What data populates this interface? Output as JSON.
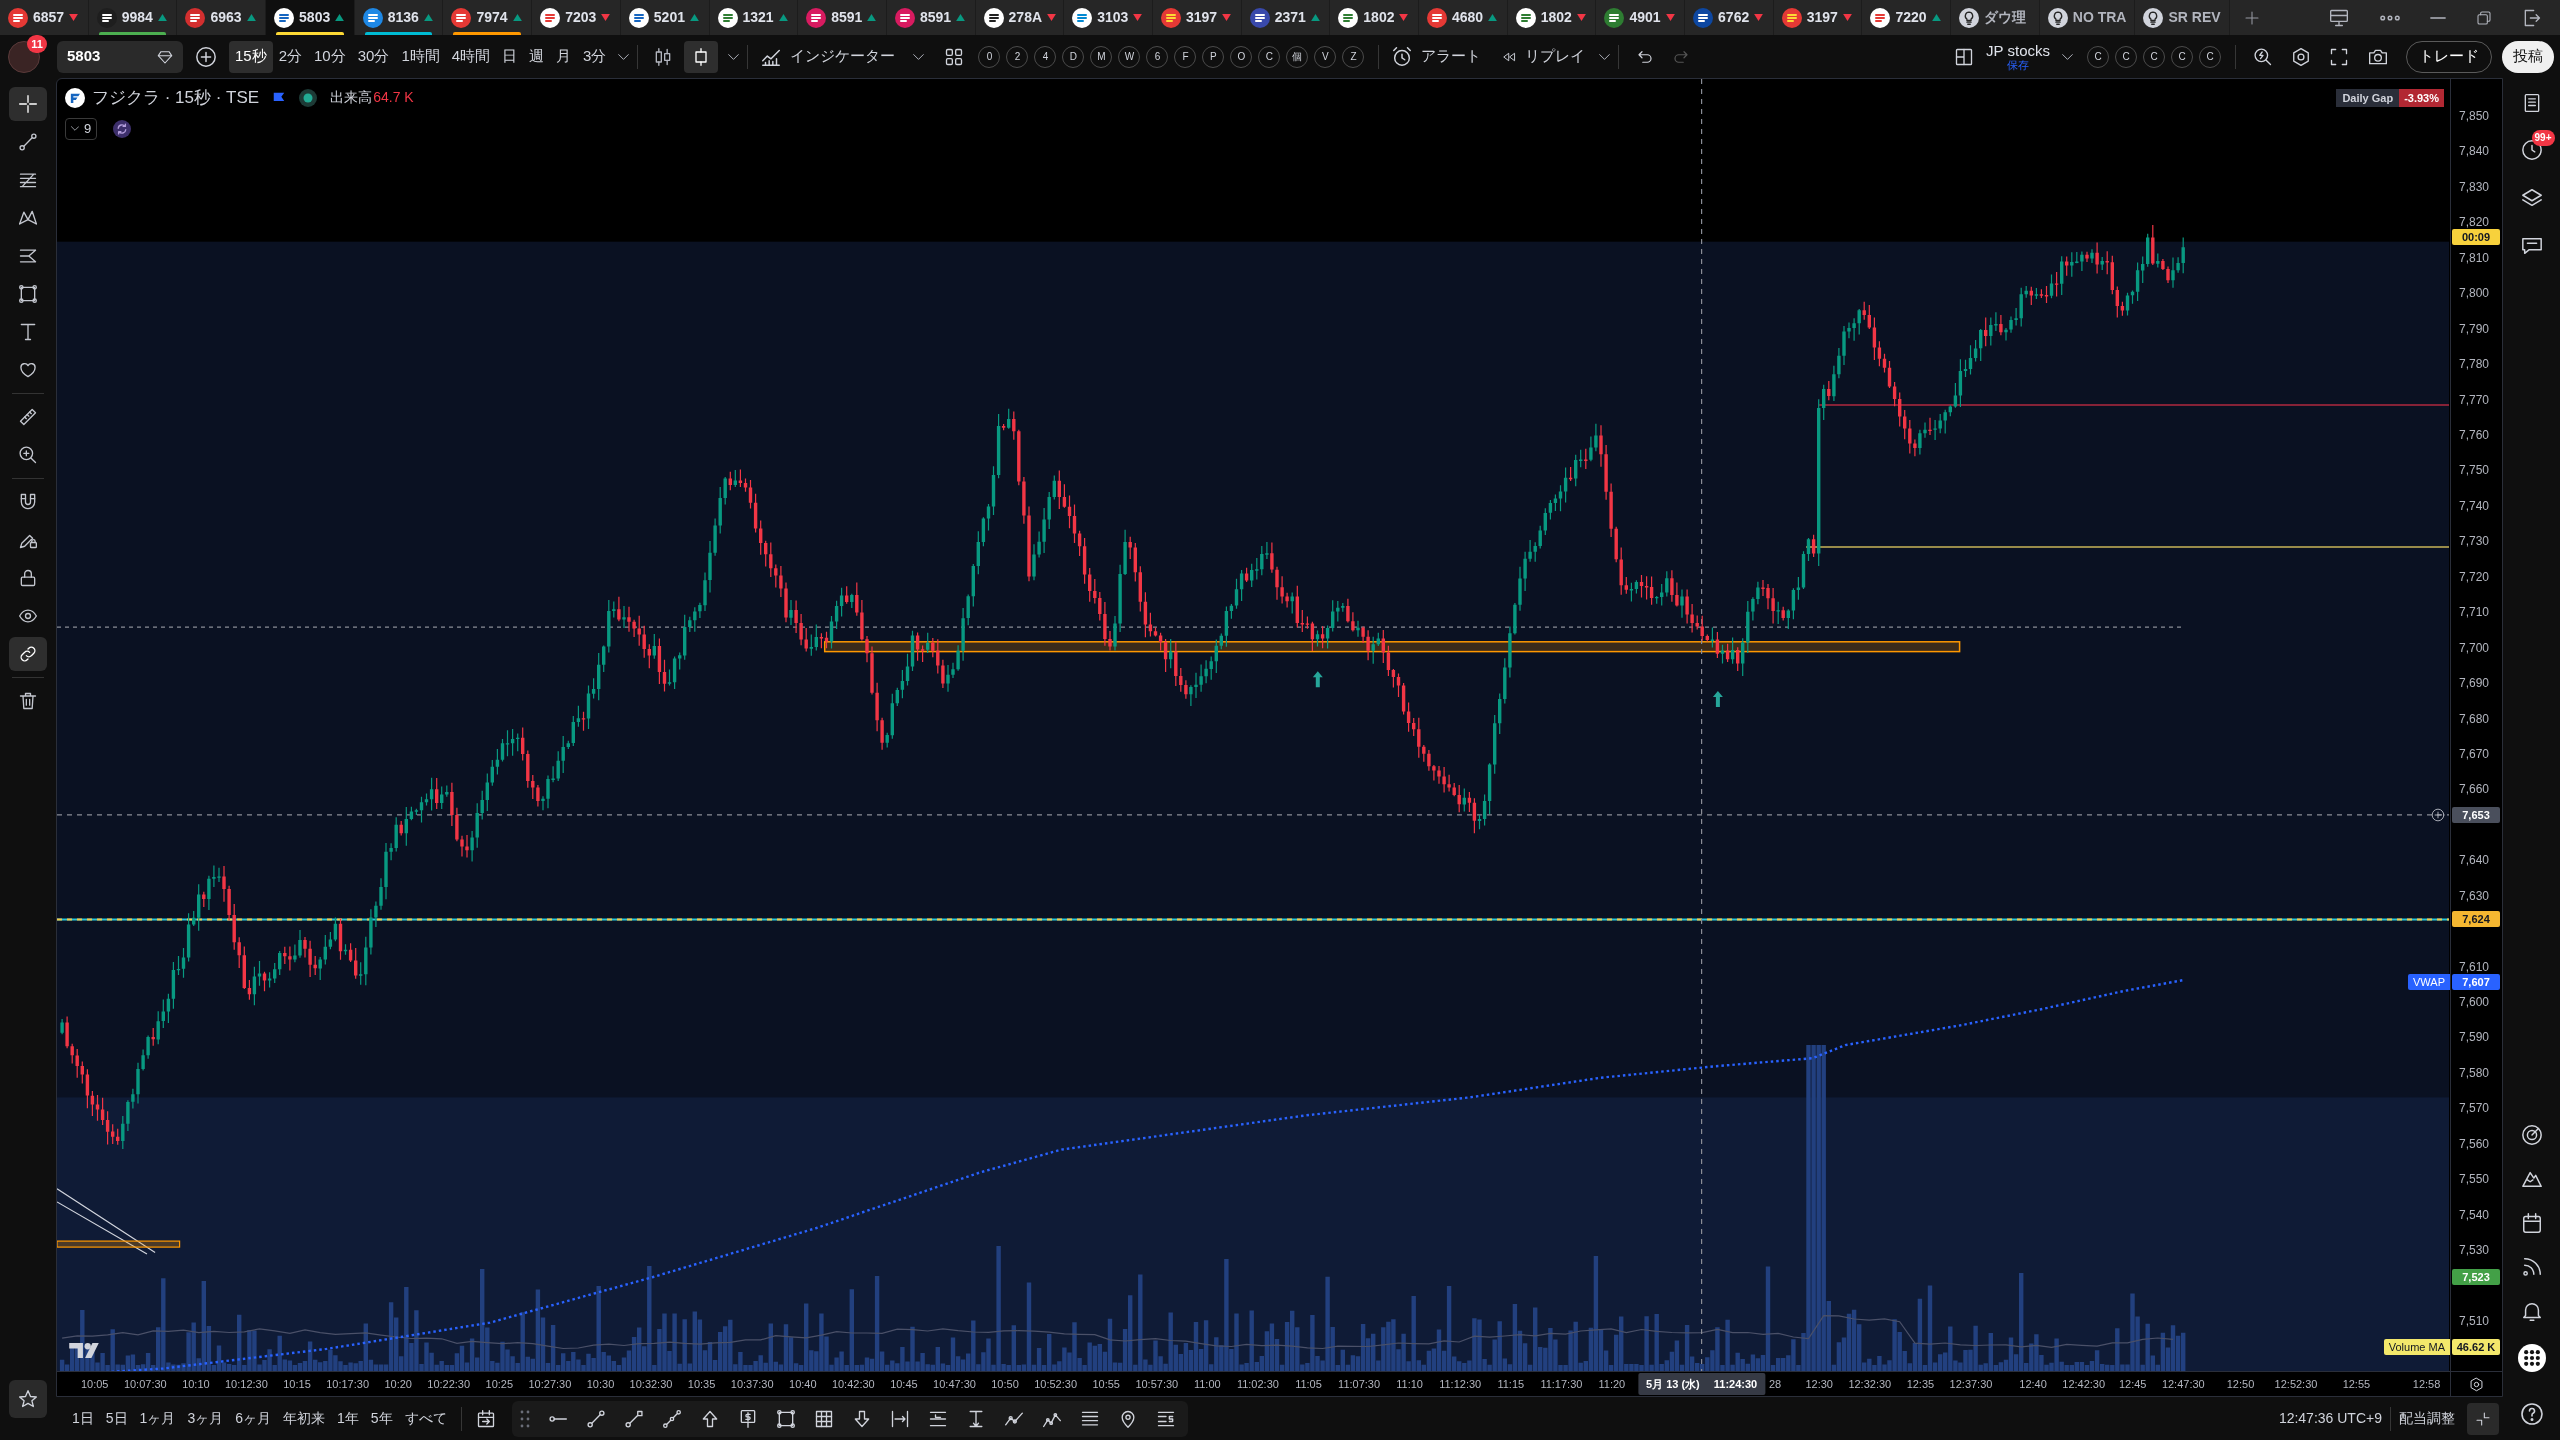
{
  "tabs": [
    {
      "kind": "symbol",
      "symbol": "6857",
      "rising": false,
      "selected": false
    },
    {
      "kind": "symbol",
      "symbol": "9984",
      "rising": true,
      "selected": false,
      "color": "#4caf50"
    },
    {
      "kind": "symbol",
      "symbol": "6963",
      "rising": true,
      "selected": false
    },
    {
      "kind": "symbol",
      "symbol": "5803",
      "rising": true,
      "selected": true,
      "color": "#fdd835"
    },
    {
      "kind": "symbol",
      "symbol": "8136",
      "rising": true,
      "selected": false,
      "color": "#00bcd4"
    },
    {
      "kind": "symbol",
      "symbol": "7974",
      "rising": true,
      "selected": false,
      "color": "#ff9800"
    },
    {
      "kind": "symbol",
      "symbol": "7203",
      "rising": false,
      "selected": false
    },
    {
      "kind": "symbol",
      "symbol": "5201",
      "rising": true,
      "selected": false
    },
    {
      "kind": "symbol",
      "symbol": "1321",
      "rising": true,
      "selected": false
    },
    {
      "kind": "symbol",
      "symbol": "8591",
      "rising": true,
      "selected": false
    },
    {
      "kind": "symbol",
      "symbol": "8591",
      "rising": true,
      "selected": false
    },
    {
      "kind": "symbol",
      "symbol": "278A",
      "rising": false,
      "selected": false
    },
    {
      "kind": "symbol",
      "symbol": "3103",
      "rising": false,
      "selected": false
    },
    {
      "kind": "symbol",
      "symbol": "3197",
      "rising": false,
      "selected": false
    },
    {
      "kind": "symbol",
      "symbol": "2371",
      "rising": true,
      "selected": false
    },
    {
      "kind": "symbol",
      "symbol": "1802",
      "rising": false,
      "selected": false
    },
    {
      "kind": "symbol",
      "symbol": "4680",
      "rising": true,
      "selected": false
    },
    {
      "kind": "symbol",
      "symbol": "1802",
      "rising": false,
      "selected": false
    },
    {
      "kind": "symbol",
      "symbol": "4901",
      "rising": false,
      "selected": false
    },
    {
      "kind": "symbol",
      "symbol": "6762",
      "rising": false,
      "selected": false
    },
    {
      "kind": "symbol",
      "symbol": "3197",
      "rising": false,
      "selected": false
    },
    {
      "kind": "symbol",
      "symbol": "7220",
      "rising": true,
      "selected": false
    },
    {
      "kind": "layout",
      "symbol": "ダウ理",
      "selected": false
    },
    {
      "kind": "layout",
      "symbol": "NO TRA",
      "selected": false
    },
    {
      "kind": "layout",
      "symbol": "SR REV",
      "selected": false
    }
  ],
  "toolbar": {
    "notification_count": "11",
    "symbol_field": {
      "value": "5803"
    },
    "intervals": [
      {
        "label": "15秒",
        "selected": true
      },
      {
        "label": "2分",
        "selected": false
      },
      {
        "label": "10分",
        "selected": false
      },
      {
        "label": "30分",
        "selected": false
      },
      {
        "label": "1時間",
        "selected": false
      },
      {
        "label": "4時間",
        "selected": false
      },
      {
        "label": "日",
        "selected": false
      },
      {
        "label": "週",
        "selected": false
      },
      {
        "label": "月",
        "selected": false
      },
      {
        "label": "3分",
        "selected": false
      }
    ],
    "chart_styles": [
      {
        "selected": false
      },
      {
        "selected": true
      }
    ],
    "indicators": "インジケーター",
    "shortcuts": [
      "0",
      "2",
      "4",
      "D",
      "M",
      "W",
      "6",
      "F",
      "P",
      "O",
      "C",
      "個",
      "V",
      "Z"
    ],
    "alert": "アラート",
    "replay": "リプレイ",
    "layout": {
      "name": "JP stocks",
      "status": "保存"
    },
    "watchlists": [
      "C",
      "C",
      "C",
      "C",
      "C"
    ],
    "trade_button": "トレード",
    "publish_button": "投稿"
  },
  "drawing_tools": [
    {
      "selected": true
    },
    {
      "selected": false
    },
    {
      "selected": false
    },
    {
      "selected": false
    },
    {
      "selected": false
    },
    {
      "selected": false
    },
    {
      "selected": false
    },
    {
      "selected": false
    },
    {
      "selected": false
    },
    {
      "selected": false
    },
    {
      "selected": false
    },
    {
      "selected": false
    },
    {
      "selected": false
    },
    {
      "selected": false
    },
    {
      "selected": true
    },
    {
      "selected": false
    }
  ],
  "chart": {
    "legend": {
      "title": "フジクラ · 15秒 · TSE",
      "volume_label": "出来高",
      "volume_value": "64.7 K",
      "hidden_count": "9"
    },
    "daily_gap": {
      "label": "Daily Gap",
      "value": "-3.93%"
    },
    "price_ticks": [
      "7,850",
      "7,840",
      "7,830",
      "7,820",
      "7,810",
      "7,800",
      "7,790",
      "7,780",
      "7,770",
      "7,760",
      "7,750",
      "7,740",
      "7,730",
      "7,720",
      "7,710",
      "7,700",
      "7,690",
      "7,680",
      "7,670",
      "7,660",
      "7,640",
      "7,630",
      "7,610",
      "7,600",
      "7,590",
      "7,580",
      "7,570",
      "7,560",
      "7,550",
      "7,540",
      "7,530",
      "7,510"
    ],
    "price_badges": [
      {
        "label": "00:09",
        "color": "#f7d13c"
      },
      {
        "label": "7,653",
        "color": "#4a4f5c"
      },
      {
        "label": "7,624",
        "color": "#f5b731"
      },
      {
        "title": "VWAP",
        "label": "7,607",
        "color": "#2962ff"
      },
      {
        "label": "7,523",
        "color": "#43a047"
      },
      {
        "title": "Volume MA",
        "label": "46.62 K",
        "color": "#f3e86b"
      }
    ],
    "time_ticks": [
      "10:05",
      "10:07:30",
      "10:10",
      "10:12:30",
      "10:15",
      "10:17:30",
      "10:20",
      "10:22:30",
      "10:25",
      "10:27:30",
      "10:30",
      "10:32:30",
      "10:35",
      "10:37:30",
      "10:40",
      "10:42:30",
      "10:45",
      "10:47:30",
      "10:50",
      "10:52:30",
      "10:55",
      "10:57:30",
      "11:00",
      "11:02:30",
      "11:05",
      "11:07:30",
      "11:10",
      "11:12:30",
      "11:15",
      "11:17:30",
      "11:20",
      "28",
      "12:30",
      "12:32:30",
      "12:35",
      "12:37:30",
      "12:40",
      "12:42:30",
      "12:45",
      "12:47:30",
      "12:50",
      "12:52:30",
      "12:55",
      "12:58"
    ],
    "crosshair": {
      "date": "5月 13 (水)",
      "time": "11:24:30"
    }
  },
  "range_buttons": [
    "1日",
    "5日",
    "1ヶ月",
    "3ヶ月",
    "6ヶ月",
    "年初来",
    "1年",
    "5年",
    "すべて"
  ],
  "status_bar": {
    "clock": "12:47:36 UTC+9",
    "adjustment": "配当調整"
  },
  "sidebar": {
    "alerts_badge": "99+"
  }
}
